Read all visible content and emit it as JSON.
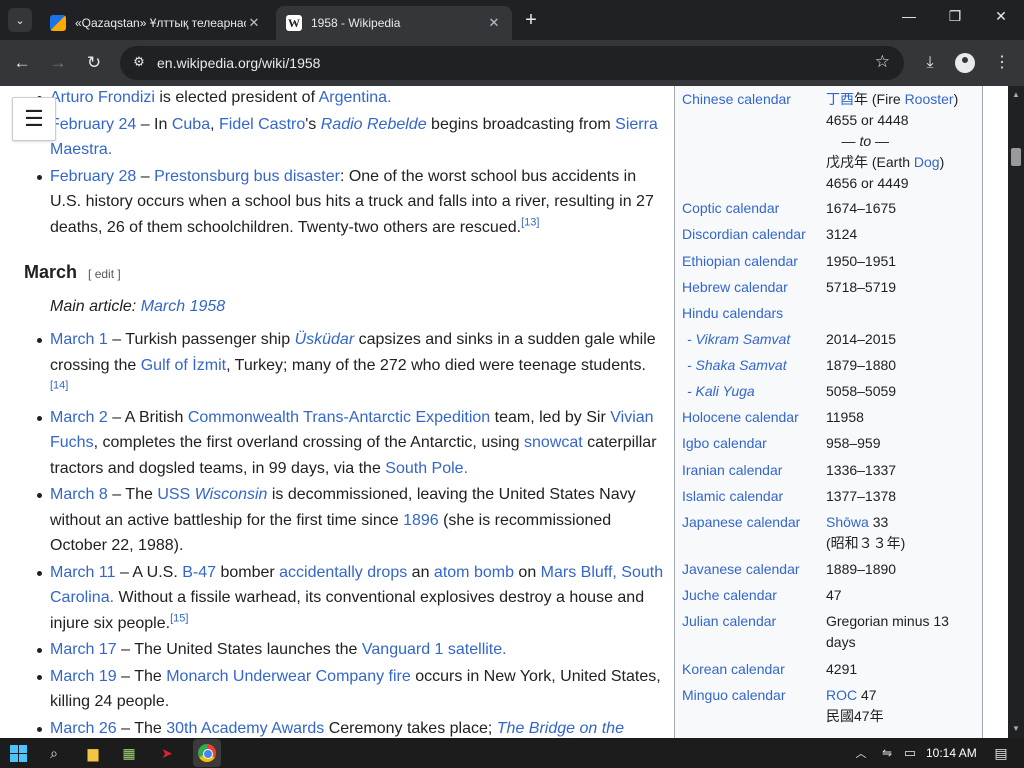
{
  "browser": {
    "tabs": [
      {
        "title": "«Qazaqstan» Ұлттық телеарнас",
        "active": false
      },
      {
        "title": "1958 - Wikipedia",
        "active": true
      }
    ],
    "url": "en.wikipedia.org/wiki/1958",
    "new_tab_glyph": "+",
    "window_controls": {
      "minimize": "—",
      "maximize": "❐",
      "close": "✕"
    }
  },
  "article": {
    "feb_items": [
      {
        "parts": [
          {
            "link": "Arturo Frondizi"
          },
          {
            "text": " is elected president of "
          },
          {
            "link": "Argentina."
          }
        ]
      },
      {
        "parts": [
          {
            "link": "February 24"
          },
          {
            "text": " – In "
          },
          {
            "link": "Cuba"
          },
          {
            "text": ", "
          },
          {
            "link": "Fidel Castro"
          },
          {
            "text": "'s "
          },
          {
            "link_italic": "Radio Rebelde"
          },
          {
            "text": " begins broadcasting from "
          },
          {
            "link": "Sierra Maestra."
          }
        ]
      },
      {
        "parts": [
          {
            "link": "February 28"
          },
          {
            "text": " – "
          },
          {
            "link": "Prestonsburg bus disaster"
          },
          {
            "text": ": One of the worst school bus accidents in U.S. history occurs when a school bus hits a truck and falls into a river, resulting in 27 deaths, 26 of them schoolchildren. Twenty-two others are rescued."
          },
          {
            "sup": "[13]"
          }
        ]
      }
    ],
    "section_heading": "March",
    "edit_label": "[ edit ]",
    "main_article_prefix": "Main article: ",
    "main_article_link": "March 1958",
    "march_items": [
      {
        "parts": [
          {
            "link": "March 1"
          },
          {
            "text": " – Turkish passenger ship "
          },
          {
            "link_italic": "Üsküdar"
          },
          {
            "text": " capsizes and sinks in a sudden gale while crossing the "
          },
          {
            "link": "Gulf of İzmit"
          },
          {
            "text": ", Turkey; many of the 272 who died were teenage students."
          },
          {
            "sup": "[14]"
          }
        ]
      },
      {
        "parts": [
          {
            "link": "March 2"
          },
          {
            "text": " – A British "
          },
          {
            "link": "Commonwealth Trans-Antarctic Expedition"
          },
          {
            "text": " team, led by Sir "
          },
          {
            "link": "Vivian Fuchs"
          },
          {
            "text": ", completes the first overland crossing of the Antarctic, using "
          },
          {
            "link": "snowcat"
          },
          {
            "text": " caterpillar tractors and dogsled teams, in 99 days, via the "
          },
          {
            "link": "South Pole."
          }
        ]
      },
      {
        "parts": [
          {
            "link": "March 8"
          },
          {
            "text": " – The "
          },
          {
            "link": "USS "
          },
          {
            "link_italic": "Wisconsin"
          },
          {
            "text": " is decommissioned, leaving the United States Navy without an active battleship for the first time since "
          },
          {
            "link": "1896"
          },
          {
            "text": " (she is recommissioned October 22, 1988)."
          }
        ]
      },
      {
        "parts": [
          {
            "link": "March 11"
          },
          {
            "text": " – A U.S. "
          },
          {
            "link": "B-47"
          },
          {
            "text": " bomber "
          },
          {
            "link": "accidentally drops"
          },
          {
            "text": " an "
          },
          {
            "link": "atom bomb"
          },
          {
            "text": " on "
          },
          {
            "link": "Mars Bluff, South Carolina."
          },
          {
            "text": " Without a fissile warhead, its conventional explosives destroy a house and injure six people."
          },
          {
            "sup": "[15]"
          }
        ]
      },
      {
        "parts": [
          {
            "link": "March 17"
          },
          {
            "text": " – The United States launches the "
          },
          {
            "link": "Vanguard 1 satellite."
          }
        ]
      },
      {
        "parts": [
          {
            "link": "March 19"
          },
          {
            "text": " – The "
          },
          {
            "link": "Monarch Underwear Company fire"
          },
          {
            "text": " occurs in New York, United States, killing 24 people."
          }
        ]
      },
      {
        "parts": [
          {
            "link": "March 26"
          },
          {
            "text": " – The "
          },
          {
            "link": "30th Academy Awards"
          },
          {
            "text": " Ceremony takes place; "
          },
          {
            "link_italic": "The Bridge on the"
          }
        ]
      }
    ]
  },
  "infobox": {
    "rows": [
      {
        "key": "Chinese calendar",
        "lines": [
          [
            {
              "link": "丁酉"
            },
            {
              "text": "年 (Fire "
            },
            {
              "link": "Rooster"
            },
            {
              "text": ")"
            }
          ],
          [
            {
              "text": "4655 or 4448"
            }
          ],
          [
            {
              "text": "    — "
            },
            {
              "italic": "to"
            },
            {
              "text": " —"
            }
          ],
          [
            {
              "text": "戊戌年 (Earth "
            },
            {
              "link": "Dog"
            },
            {
              "text": ")"
            }
          ],
          [
            {
              "text": "4656 or 4449"
            }
          ]
        ]
      },
      {
        "key": "Coptic calendar",
        "lines": [
          [
            {
              "text": "1674–1675"
            }
          ]
        ]
      },
      {
        "key": "Discordian calendar",
        "lines": [
          [
            {
              "text": "3124"
            }
          ]
        ]
      },
      {
        "key": "Ethiopian calendar",
        "lines": [
          [
            {
              "text": "1950–1951"
            }
          ]
        ]
      },
      {
        "key": "Hebrew calendar",
        "lines": [
          [
            {
              "text": "5718–5719"
            }
          ]
        ]
      },
      {
        "key": "Hindu calendars",
        "lines": []
      },
      {
        "key": "- Vikram Samvat",
        "sub": true,
        "lines": [
          [
            {
              "text": "2014–2015"
            }
          ]
        ]
      },
      {
        "key": "- Shaka Samvat",
        "sub": true,
        "lines": [
          [
            {
              "text": "1879–1880"
            }
          ]
        ]
      },
      {
        "key": "- Kali Yuga",
        "sub": true,
        "lines": [
          [
            {
              "text": "5058–5059"
            }
          ]
        ]
      },
      {
        "key": "Holocene calendar",
        "lines": [
          [
            {
              "text": "11958"
            }
          ]
        ]
      },
      {
        "key": "Igbo calendar",
        "lines": [
          [
            {
              "text": "958–959"
            }
          ]
        ]
      },
      {
        "key": "Iranian calendar",
        "lines": [
          [
            {
              "text": "1336–1337"
            }
          ]
        ]
      },
      {
        "key": "Islamic calendar",
        "lines": [
          [
            {
              "text": "1377–1378"
            }
          ]
        ]
      },
      {
        "key": "Japanese calendar",
        "lines": [
          [
            {
              "link": "Shōwa"
            },
            {
              "text": " 33"
            }
          ],
          [
            {
              "text": "(昭和３３年)"
            }
          ]
        ]
      },
      {
        "key": "Javanese calendar",
        "lines": [
          [
            {
              "text": "1889–1890"
            }
          ]
        ]
      },
      {
        "key": "Juche calendar",
        "lines": [
          [
            {
              "text": "47"
            }
          ]
        ]
      },
      {
        "key": "Julian calendar",
        "lines": [
          [
            {
              "text": "Gregorian minus 13"
            }
          ],
          [
            {
              "text": "days"
            }
          ]
        ]
      },
      {
        "key": "Korean calendar",
        "lines": [
          [
            {
              "text": "4291"
            }
          ]
        ]
      },
      {
        "key": "Minguo calendar",
        "lines": [
          [
            {
              "link": "ROC"
            },
            {
              "text": " 47"
            }
          ],
          [
            {
              "text": "民國47年"
            }
          ]
        ]
      }
    ]
  },
  "taskbar": {
    "time": "10:14 AM"
  },
  "colors": {
    "link": "#3366cc",
    "titlebar": "#202124",
    "toolbar": "#35363a"
  }
}
